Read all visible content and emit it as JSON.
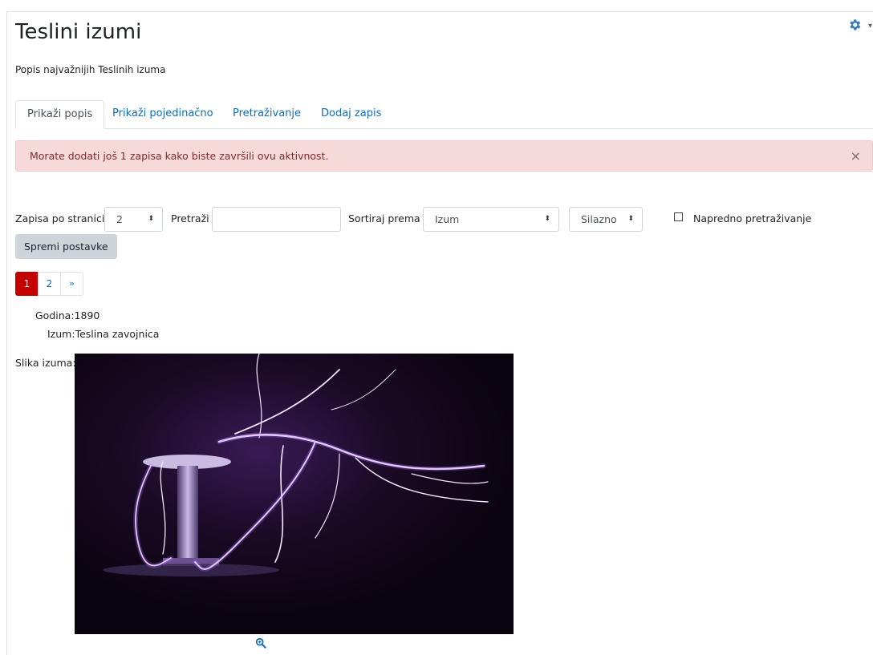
{
  "page": {
    "title": "Teslini izumi",
    "intro": "Popis najvažnijih Teslinih izuma"
  },
  "tabs": [
    {
      "label": "Prikaži popis",
      "active": true
    },
    {
      "label": "Prikaži pojedinačno",
      "active": false
    },
    {
      "label": "Pretraživanje",
      "active": false
    },
    {
      "label": "Dodaj zapis",
      "active": false
    }
  ],
  "alert": {
    "message": "Morate dodati još 1 zapisa kako biste završili ovu aktivnost.",
    "close": "×"
  },
  "controls": {
    "per_page_label": "Zapisa po stranici",
    "per_page_value": "2",
    "search_label": "Pretraži",
    "search_value": "",
    "sort_label": "Sortiraj prema",
    "sort_value": "Izum",
    "order_value": "Silazno",
    "advanced_label": "Napredno pretraživanje",
    "advanced_checked": false,
    "save_label": "Spremi postavke"
  },
  "pagination": {
    "pages": [
      "1",
      "2"
    ],
    "current": "1",
    "next": "»"
  },
  "record": {
    "year_label": "Godina:",
    "year_value": "1890",
    "name_label": "Izum:",
    "name_value": "Teslina zavojnica",
    "image_label": "Slika izuma:"
  },
  "icons": {
    "settings": "gear-icon",
    "zoom": "zoom-in-icon"
  },
  "colors": {
    "link": "#0f6cbf",
    "active_page": "#c50000",
    "alert_bg": "#f6dada",
    "alert_text": "#7d2a2a",
    "gear": "#3a7ab8"
  }
}
